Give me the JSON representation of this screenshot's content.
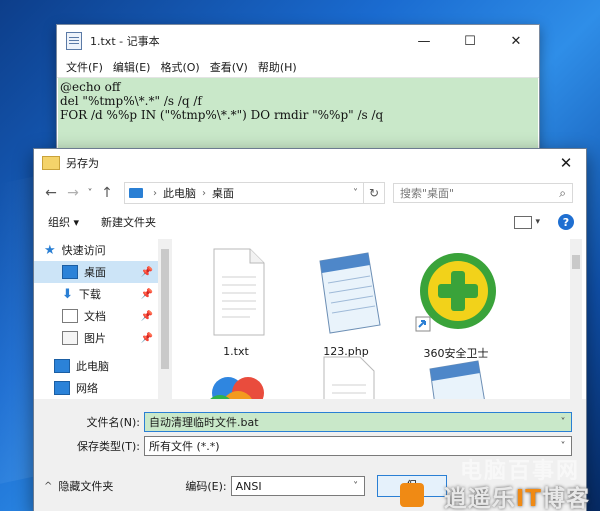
{
  "notepad": {
    "title": "1.txt - 记事本",
    "controls": {
      "minimize": "—",
      "maximize": "☐",
      "close": "✕"
    },
    "menu": [
      "文件(F)",
      "编辑(E)",
      "格式(O)",
      "查看(V)",
      "帮助(H)"
    ],
    "content_lines": [
      "@echo off",
      "del \"%tmp%\\*.*\" /s /q /f",
      "FOR /d %%p IN (\"%tmp%\\*.*\") DO rmdir \"%%p\" /s /q"
    ]
  },
  "saveas": {
    "title": "另存为",
    "close": "✕",
    "nav": {
      "back": "←",
      "forward": "→",
      "dropdown": "˅",
      "up": "↑"
    },
    "address": {
      "segments": [
        "此电脑",
        "桌面"
      ],
      "separator": "›",
      "refresh": "↻"
    },
    "search": {
      "placeholder": "搜索\"桌面\"",
      "icon": "⌕"
    },
    "toolbar": {
      "organize": "组织 ▾",
      "new_folder": "新建文件夹",
      "help": "?"
    },
    "tree": [
      {
        "label": "快速访问",
        "icon": "star-icon"
      },
      {
        "label": "桌面",
        "icon": "desktop-icon",
        "selected": true,
        "pinned": true
      },
      {
        "label": "下载",
        "icon": "download-icon",
        "pinned": true
      },
      {
        "label": "文档",
        "icon": "documents-icon",
        "pinned": true
      },
      {
        "label": "图片",
        "icon": "pictures-icon",
        "pinned": true
      },
      {
        "label": "此电脑",
        "icon": "computer-icon"
      },
      {
        "label": "网络",
        "icon": "network-icon"
      }
    ],
    "pin_glyph": "📌",
    "files": [
      {
        "name": "1.txt",
        "type": "text"
      },
      {
        "name": "123.php",
        "type": "notepad"
      },
      {
        "name": "360安全卫士",
        "type": "360"
      },
      {
        "name": "",
        "type": "photos"
      },
      {
        "name": "",
        "type": "text"
      },
      {
        "name": "",
        "type": "notepad"
      }
    ],
    "filename": {
      "label": "文件名(N):",
      "value": "自动清理临时文件.bat",
      "dropdown": "˅"
    },
    "filetype": {
      "label": "保存类型(T):",
      "value": "所有文件 (*.*)",
      "dropdown": "˅"
    },
    "footer": {
      "hide_folders": "隐藏文件夹",
      "caret": "^",
      "encoding_label": "编码(E):",
      "encoding_value": "ANSI",
      "dropdown": "˅",
      "save_label": "保"
    }
  },
  "watermark": {
    "line1": "电脑百事网",
    "line2_a": "逍遥乐",
    "line2_b": "IT",
    "line2_c": "博客"
  }
}
